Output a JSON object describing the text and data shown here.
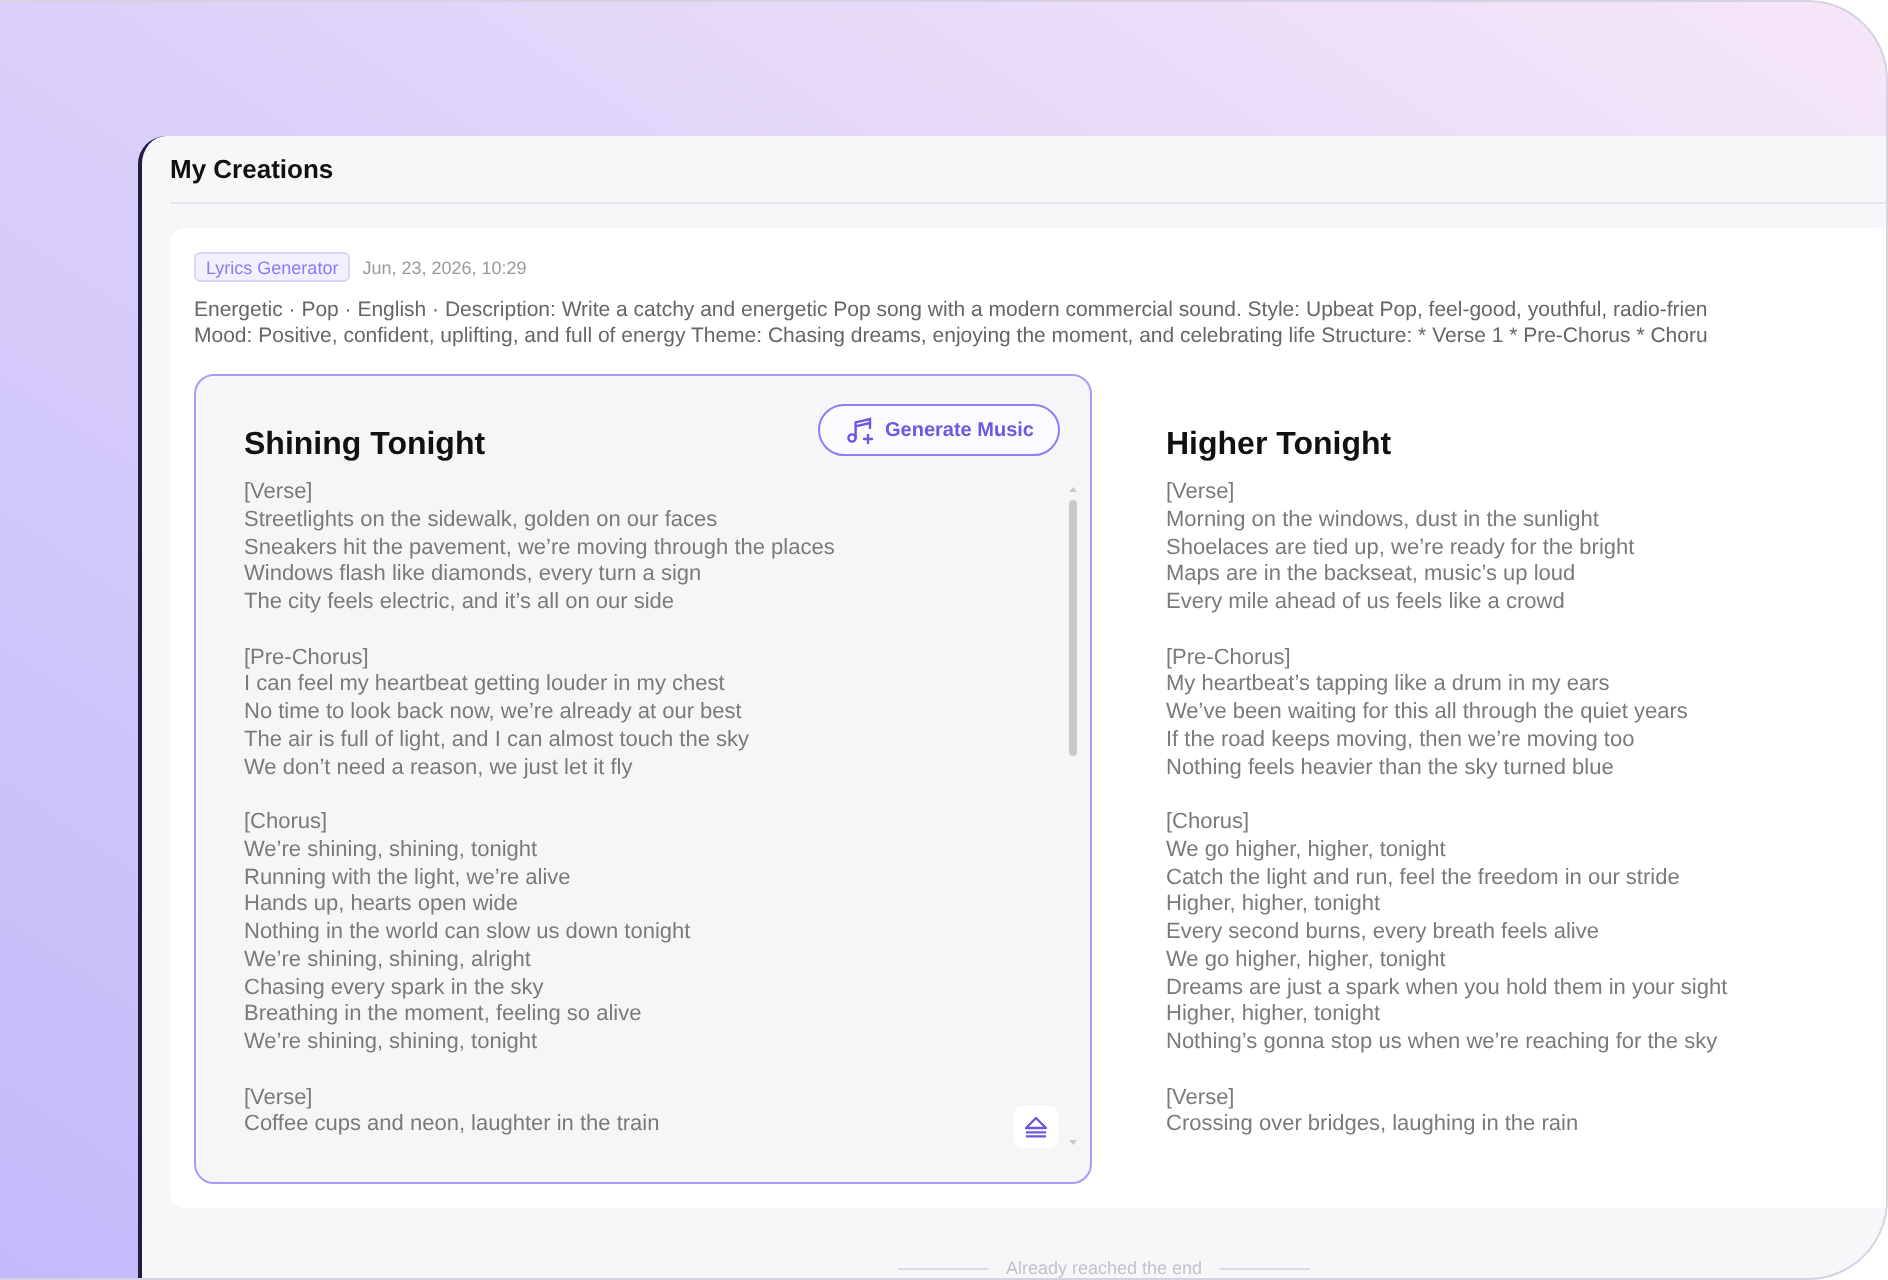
{
  "page": {
    "title": "My Creations"
  },
  "creation": {
    "tag": "Lyrics Generator",
    "date": "Jun, 23, 2026, 10:29",
    "description_lines": [
      "Energetic · Pop · English · Description: Write a catchy and energetic Pop song with a modern commercial sound. Style: Upbeat Pop, feel-good, youthful, radio-frien",
      "Mood: Positive, confident, uplifting, and full of energy Theme: Chasing dreams, enjoying the moment, and celebrating life Structure: * Verse 1 * Pre-Chorus * Choru"
    ],
    "songs": [
      {
        "title": "Shining Tonight",
        "selected": true,
        "button": "Generate Music",
        "sections": [
          {
            "heading": "[Verse]",
            "lines": [
              "Streetlights on the sidewalk, golden on our faces",
              "Sneakers hit the pavement, we’re moving through the places",
              "Windows flash like diamonds, every turn a sign",
              "The city feels electric, and it’s all on our side"
            ]
          },
          {
            "heading": "[Pre-Chorus]",
            "lines": [
              "I can feel my heartbeat getting louder in my chest",
              "No time to look back now, we’re already at our best",
              "The air is full of light, and I can almost touch the sky",
              "We don’t need a reason, we just let it fly"
            ]
          },
          {
            "heading": "[Chorus]",
            "lines": [
              "We’re shining, shining, tonight",
              "Running with the light, we’re alive",
              "Hands up, hearts open wide",
              "Nothing in the world can slow us down tonight",
              "We’re shining, shining, alright",
              "Chasing every spark in the sky",
              "Breathing in the moment, feeling so alive",
              "We’re shining, shining, tonight"
            ]
          },
          {
            "heading": "[Verse]",
            "lines": [
              "Coffee cups and neon, laughter in the train"
            ]
          }
        ]
      },
      {
        "title": "Higher Tonight",
        "selected": false,
        "sections": [
          {
            "heading": "[Verse]",
            "lines": [
              "Morning on the windows, dust in the sunlight",
              "Shoelaces are tied up, we’re ready for the bright",
              "Maps are in the backseat, music’s up loud",
              "Every mile ahead of us feels like a crowd"
            ]
          },
          {
            "heading": "[Pre-Chorus]",
            "lines": [
              "My heartbeat’s tapping like a drum in my ears",
              "We’ve been waiting for this all through the quiet years",
              "If the road keeps moving, then we’re moving too",
              "Nothing feels heavier than the sky turned blue"
            ]
          },
          {
            "heading": "[Chorus]",
            "lines": [
              "We go higher, higher, tonight",
              "Catch the light and run, feel the freedom in our stride",
              "Higher, higher, tonight",
              "Every second burns, every breath feels alive",
              "We go higher, higher, tonight",
              "Dreams are just a spark when you hold them in your sight",
              "Higher, higher, tonight",
              "Nothing’s gonna stop us when we’re reaching for the sky"
            ]
          },
          {
            "heading": "[Verse]",
            "lines": [
              "Crossing over bridges, laughing in the rain"
            ]
          }
        ]
      }
    ]
  },
  "footer": {
    "end_note": "Already reached the end"
  }
}
